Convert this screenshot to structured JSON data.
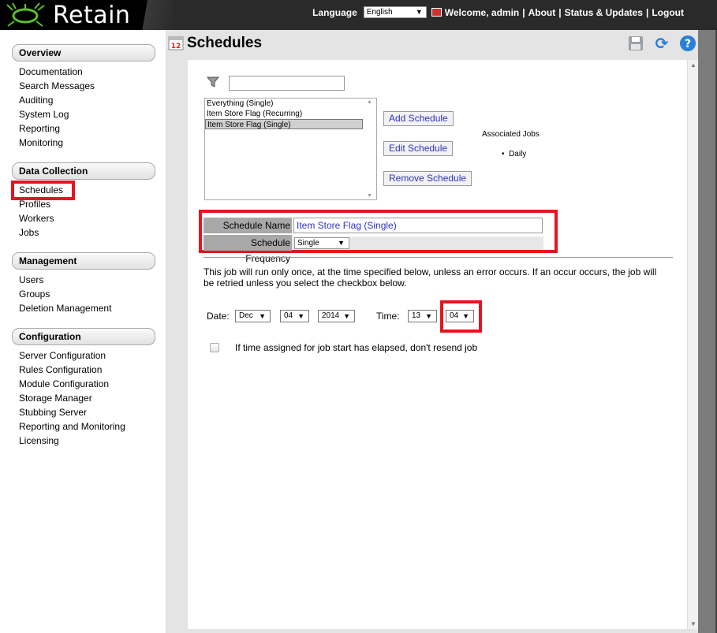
{
  "app": {
    "logo_text": "Retain",
    "language_label": "Language",
    "language_value": "English",
    "welcome": "Welcome, admin",
    "links": [
      "About",
      "Status & Updates",
      "Logout"
    ],
    "separator": "|"
  },
  "sidebar": {
    "sections": [
      {
        "header": "Overview",
        "items": [
          "Documentation",
          "Search Messages",
          "Auditing",
          "System Log",
          "Reporting",
          "Monitoring"
        ]
      },
      {
        "header": "Data Collection",
        "items": [
          "Schedules",
          "Profiles",
          "Workers",
          "Jobs"
        ]
      },
      {
        "header": "Management",
        "items": [
          "Users",
          "Groups",
          "Deletion Management"
        ]
      },
      {
        "header": "Configuration",
        "items": [
          "Server Configuration",
          "Rules Configuration",
          "Module Configuration",
          "Storage Manager",
          "Stubbing Server",
          "Reporting and Monitoring",
          "Licensing"
        ]
      }
    ]
  },
  "page": {
    "title": "Schedules",
    "title_icon": "calendar-icon",
    "calendar_day": "12",
    "toolbar_icons": [
      "save-icon",
      "refresh-icon",
      "help-icon"
    ],
    "help_glyph": "?",
    "refresh_glyph": "⟳"
  },
  "filter": {
    "icon": "filter-icon",
    "value": ""
  },
  "schedules": {
    "list": [
      "Everything (Single)",
      "Item Store Flag (Recurring)",
      "Item Store Flag (Single)"
    ],
    "selected_index": 2,
    "buttons": {
      "add": "Add Schedule",
      "edit": "Edit Schedule",
      "remove": "Remove Schedule"
    },
    "associated_jobs_title": "Associated Jobs",
    "associated_jobs": [
      "Daily"
    ]
  },
  "form": {
    "name_label": "Schedule Name",
    "name_value": "Item Store Flag (Single)",
    "frequency_label": "Schedule Frequency",
    "frequency_value": "Single",
    "info": "This job will run only once, at the time specified below, unless an error occurs. If an occur occurs, the job will be retried unless you select the checkbox below.",
    "date_label": "Date:",
    "month": "Dec",
    "day": "04",
    "year": "2014",
    "time_label": "Time:",
    "hour": "13",
    "minute": "04",
    "resend_label": "If time assigned for job start has elapsed, don't resend job",
    "resend_checked": false
  },
  "colors": {
    "highlight": "#e4151f",
    "link_blue": "#3030c8",
    "header_bg": "#2a2a2a"
  }
}
